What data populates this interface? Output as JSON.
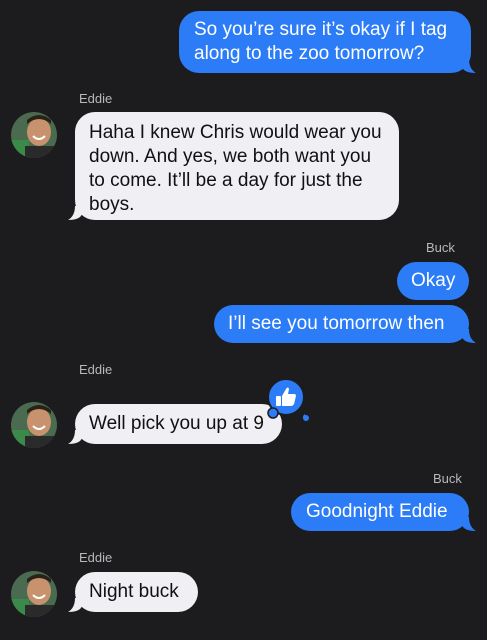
{
  "conversation": {
    "messages": [
      {
        "direction": "outgoing",
        "text": "So you’re sure it’s okay if I tag along to the zoo tomorrow?"
      },
      {
        "direction": "incoming",
        "sender": "Eddie",
        "text": "Haha I knew Chris would wear you down. And yes, we both want you to come. It’ll be a day for just the boys."
      },
      {
        "direction": "outgoing",
        "sender": "Buck",
        "text": "Okay"
      },
      {
        "direction": "outgoing",
        "text": "I’ll see you tomorrow then"
      },
      {
        "direction": "incoming",
        "sender": "Eddie",
        "text": "Well pick you up at 9",
        "reaction": "thumbs-up-icon"
      },
      {
        "direction": "outgoing",
        "sender": "Buck",
        "text": "Goodnight Eddie"
      },
      {
        "direction": "incoming",
        "sender": "Eddie",
        "text": "Night buck"
      }
    ]
  },
  "colors": {
    "background": "#1c1c1e",
    "outgoing_bubble": "#2b7cf6",
    "incoming_bubble": "#efeff4",
    "sender_label": "#b8b8bd"
  }
}
